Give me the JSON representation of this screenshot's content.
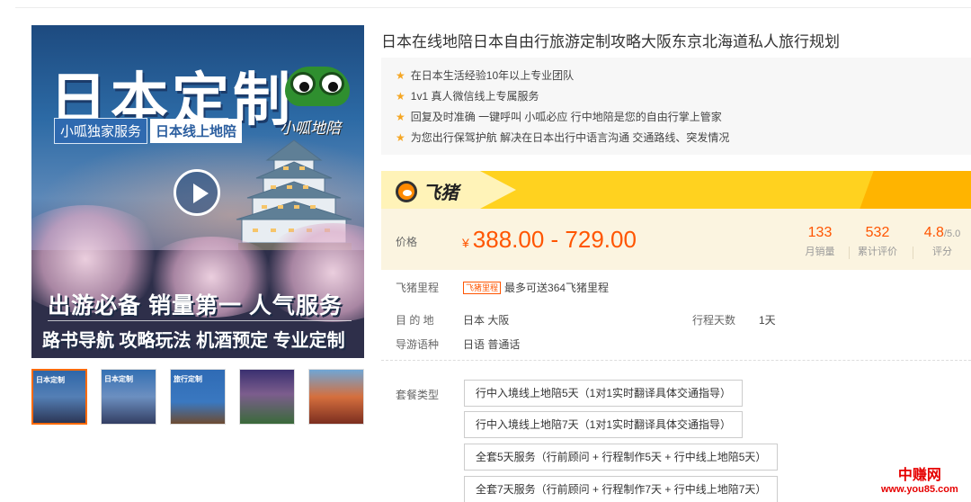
{
  "gallery": {
    "hero_title": "日本定制",
    "badge_left": "小呱独家服务",
    "badge_right": "日本线上地陪",
    "script_text": "小呱地陪",
    "slogan_line1": "出游必备 销量第一 人气服务",
    "slogan_line2": "路书导航 攻略玩法 机酒预定 专业定制",
    "play_icon": "play-icon",
    "thumbnails": [
      {
        "label": "日本定制"
      },
      {
        "label": "日本定制"
      },
      {
        "label": "旅行定制"
      },
      {
        "label": ""
      },
      {
        "label": ""
      },
      {
        "label": ""
      }
    ]
  },
  "product": {
    "title": "日本在线地陪日本自由行旅游定制攻略大阪东京北海道私人旅行规划",
    "features": [
      "在日本生活经验10年以上专业团队",
      "1v1 真人微信线上专属服务",
      "回复及时准确 一键呼叫 小呱必应 行中地陪是您的自由行掌上管家",
      "为您出行保驾护航 解决在日本出行中语言沟通 交通路线、突发情况"
    ]
  },
  "brand": {
    "name": "飞猪",
    "icon": "fliggy-pig-icon",
    "bar_color": "#ffd21f"
  },
  "price": {
    "label": "价格",
    "currency": "¥",
    "value": "388.00 - 729.00",
    "accent_color": "#ff5500"
  },
  "stats": {
    "monthly_sales": {
      "value": "133",
      "label": "月销量"
    },
    "total_reviews": {
      "value": "532",
      "label": "累计评价"
    },
    "rating": {
      "value": "4.8",
      "max": "/5.0",
      "label": "评分"
    }
  },
  "details": {
    "miles_label": "飞猪里程",
    "miles_tag": "飞猪里程",
    "miles_text": "最多可送364飞猪里程",
    "destination_label": "目 的 地",
    "destination_value": "日本  大阪",
    "duration_label": "行程天数",
    "duration_value": "1天",
    "language_label": "导游语种",
    "language_value": "日语  普通话"
  },
  "packages": {
    "label": "套餐类型",
    "options": [
      "行中入境线上地陪5天（1对1实时翻译具体交通指导）",
      "行中入境线上地陪7天（1对1实时翻译具体交通指导）",
      "全套5天服务（行前顾问 + 行程制作5天 + 行中线上地陪5天）",
      "全套7天服务（行前顾问 + 行程制作7天 + 行中线上地陪7天）"
    ]
  },
  "watermark": {
    "name": "中赚网",
    "url": "www.you85.com"
  }
}
